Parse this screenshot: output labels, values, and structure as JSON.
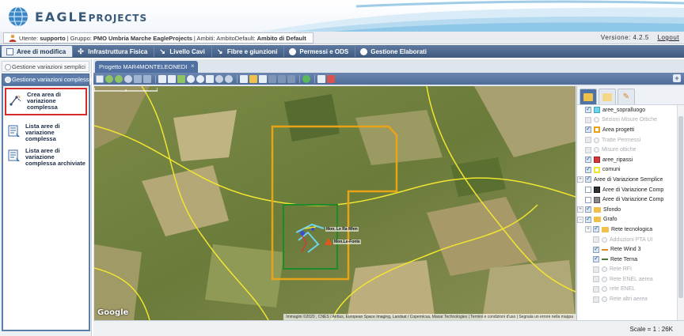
{
  "header": {
    "logo_main": "EAGLE",
    "logo_sub": "PROJECTS"
  },
  "userbar": {
    "utente_label": "Utente:",
    "utente_value": "supporto",
    "gruppo_label": "| Gruppo:",
    "gruppo_value": "PMO Umbria Marche EagleProjects",
    "ambiti_label": "| Ambiti:",
    "ambiti_value": "AmbitoDefault:",
    "ambito_label": "Ambito di Default",
    "version": "Versione: 4.2.5",
    "logout": "Logout"
  },
  "menu": [
    {
      "label": "Aree di modifica"
    },
    {
      "label": "Infrastruttura Fisica"
    },
    {
      "label": "Livello Cavi"
    },
    {
      "label": "Fibre e giunzioni"
    },
    {
      "label": "Permessi e ODS"
    },
    {
      "label": "Gestione Elaborati"
    }
  ],
  "leftpanel": {
    "section1": "Gestione variazioni semplici",
    "section2": "Gestione variazioni complesse",
    "tools": [
      {
        "label": "Crea area di variazione complessa"
      },
      {
        "label": "Lista aree di variazione complessa"
      },
      {
        "label": "Lista aree di variazione complessa archiviate"
      }
    ]
  },
  "tab": {
    "label": "Progetto MAR4MONTELEONEDI",
    "close": "×"
  },
  "map": {
    "google": "Google",
    "attribution": "Immagini ©2020 , CNES / Airbus, European Space Imaging, Landsat / Copernicus, Maxar Technologies | Termini e condizioni d'uso | Segnala un errore nella mappa",
    "label1": "Mon. Le Ra Mhm",
    "label2": "Mon.Le-Fonte"
  },
  "layers": [
    {
      "label": "aree_sopralluogo"
    },
    {
      "label": "Sezioni Misure Ottiche"
    },
    {
      "label": "Area progetti"
    },
    {
      "label": "Tratte Permessi"
    },
    {
      "label": "Misure ottiche"
    },
    {
      "label": "aree_ripassi"
    },
    {
      "label": "comuni"
    },
    {
      "label": "Aree di Variazione Semplice"
    },
    {
      "label": "Aree di Variazione Comp"
    },
    {
      "label": "Aree di Variazione Comp"
    },
    {
      "label": "Sfondo"
    },
    {
      "label": "Grafo"
    },
    {
      "label": "Rete tecnologica"
    },
    {
      "label": "Adduzioni PTA UI"
    },
    {
      "label": "Rete Wind 3"
    },
    {
      "label": "Rete Terna"
    },
    {
      "label": "Rete RFI"
    },
    {
      "label": "Rete ENEL aerea"
    },
    {
      "label": "rete ENEL"
    },
    {
      "label": "Rete altri aerea"
    }
  ],
  "status": {
    "scale": "Scale = 1 : 26K"
  },
  "colors": {
    "menubar": "#4f6a90",
    "selected_accent": "#5d7dab",
    "highlight_border": "#d62b2b",
    "area_progetti": "#e8a317",
    "aree_sopralluogo": "#6dd3ef",
    "aree_ripassi": "#d33a3a",
    "comuni": "#f2e531"
  }
}
